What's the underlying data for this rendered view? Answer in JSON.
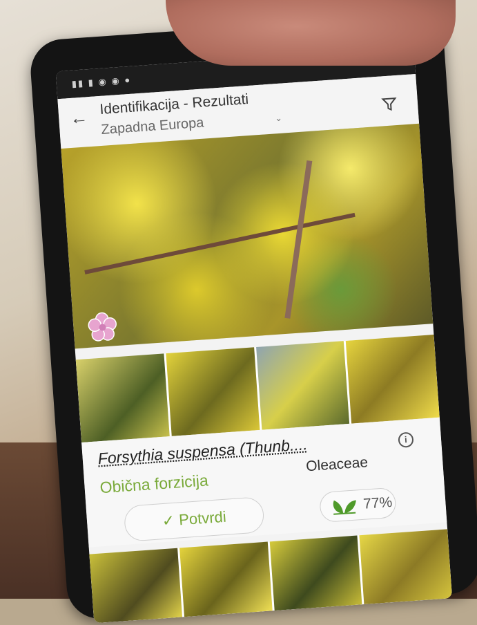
{
  "app": {
    "title": "Identifikacija - Rezultati",
    "region": "Zapadna Europa"
  },
  "result": {
    "latin_name": "Forsythia suspensa (Thunb....",
    "common_name": "Obična forzicija",
    "family": "Oleaceae",
    "confirm_label": "✓ Potvrdi",
    "confidence": "77%"
  },
  "icons": {
    "back": "back-arrow-icon",
    "filter": "filter-icon",
    "dropdown": "chevron-down-icon",
    "info": "info-icon",
    "flower": "flower-icon",
    "leaf": "leaf-icon"
  },
  "colors": {
    "accent_green": "#7aaa3a",
    "flower_pink": "#e7a4cf"
  }
}
